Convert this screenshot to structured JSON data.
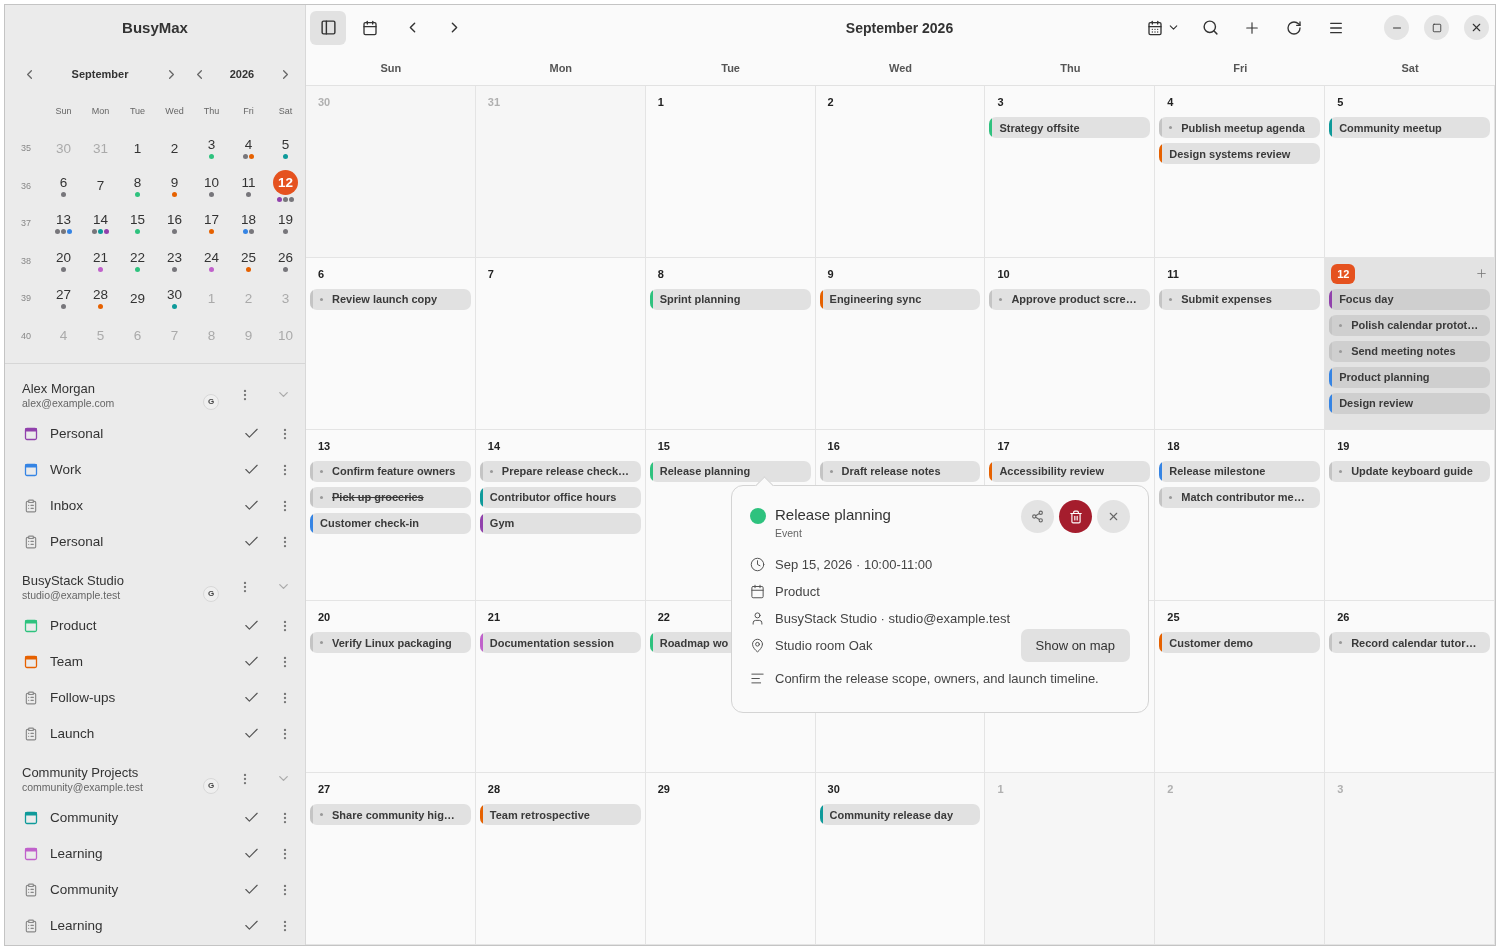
{
  "app_title": "BusyMax",
  "mini_calendar": {
    "month": "September",
    "year": "2026",
    "weekdays": [
      "Sun",
      "Mon",
      "Tue",
      "Wed",
      "Thu",
      "Fri",
      "Sat"
    ],
    "weeks": [
      {
        "week": "35",
        "days": [
          {
            "day": "30",
            "muted": true,
            "selected": false
          },
          {
            "day": "31",
            "muted": true,
            "selected": false
          },
          {
            "day": "1",
            "muted": false,
            "selected": false
          },
          {
            "day": "2",
            "muted": false,
            "selected": false
          },
          {
            "day": "3",
            "muted": false,
            "selected": false,
            "dots": [
              {
                "color": "#2ec27e"
              }
            ]
          },
          {
            "day": "4",
            "muted": false,
            "selected": false,
            "dots": [
              {
                "color": "#77767b"
              },
              {
                "color": "#e66100"
              }
            ]
          },
          {
            "day": "5",
            "muted": false,
            "selected": false,
            "dots": [
              {
                "color": "#0e9a9a"
              }
            ]
          }
        ]
      },
      {
        "week": "36",
        "days": [
          {
            "day": "6",
            "muted": false,
            "selected": false,
            "dots": [
              {
                "color": "#77767b"
              }
            ]
          },
          {
            "day": "7",
            "muted": false,
            "selected": false
          },
          {
            "day": "8",
            "muted": false,
            "selected": false,
            "dots": [
              {
                "color": "#2ec27e"
              }
            ]
          },
          {
            "day": "9",
            "muted": false,
            "selected": false,
            "dots": [
              {
                "color": "#e66100"
              }
            ]
          },
          {
            "day": "10",
            "muted": false,
            "selected": false,
            "dots": [
              {
                "color": "#77767b"
              }
            ]
          },
          {
            "day": "11",
            "muted": false,
            "selected": false,
            "dots": [
              {
                "color": "#77767b"
              }
            ]
          },
          {
            "day": "12",
            "muted": false,
            "selected": true,
            "dots": [
              {
                "color": "#9141ac"
              },
              {
                "color": "#77767b"
              },
              {
                "color": "#77767b"
              }
            ]
          }
        ]
      },
      {
        "week": "37",
        "days": [
          {
            "day": "13",
            "muted": false,
            "selected": false,
            "dots": [
              {
                "color": "#77767b"
              },
              {
                "color": "#77767b"
              },
              {
                "color": "#3584e4"
              }
            ]
          },
          {
            "day": "14",
            "muted": false,
            "selected": false,
            "dots": [
              {
                "color": "#77767b"
              },
              {
                "color": "#0e9a9a"
              },
              {
                "color": "#9141ac"
              }
            ]
          },
          {
            "day": "15",
            "muted": false,
            "selected": false,
            "dots": [
              {
                "color": "#2ec27e"
              }
            ]
          },
          {
            "day": "16",
            "muted": false,
            "selected": false,
            "dots": [
              {
                "color": "#77767b"
              }
            ]
          },
          {
            "day": "17",
            "muted": false,
            "selected": false,
            "dots": [
              {
                "color": "#e66100"
              }
            ]
          },
          {
            "day": "18",
            "muted": false,
            "selected": false,
            "dots": [
              {
                "color": "#3584e4"
              },
              {
                "color": "#77767b"
              }
            ]
          },
          {
            "day": "19",
            "muted": false,
            "selected": false,
            "dots": [
              {
                "color": "#77767b"
              }
            ]
          }
        ]
      },
      {
        "week": "38",
        "days": [
          {
            "day": "20",
            "muted": false,
            "selected": false,
            "dots": [
              {
                "color": "#77767b"
              }
            ]
          },
          {
            "day": "21",
            "muted": false,
            "selected": false,
            "dots": [
              {
                "color": "#c061cb"
              }
            ]
          },
          {
            "day": "22",
            "muted": false,
            "selected": false,
            "dots": [
              {
                "color": "#2ec27e"
              }
            ]
          },
          {
            "day": "23",
            "muted": false,
            "selected": false,
            "dots": [
              {
                "color": "#77767b"
              }
            ]
          },
          {
            "day": "24",
            "muted": false,
            "selected": false,
            "dots": [
              {
                "color": "#c061cb"
              }
            ]
          },
          {
            "day": "25",
            "muted": false,
            "selected": false,
            "dots": [
              {
                "color": "#e66100"
              }
            ]
          },
          {
            "day": "26",
            "muted": false,
            "selected": false,
            "dots": [
              {
                "color": "#77767b"
              }
            ]
          }
        ]
      },
      {
        "week": "39",
        "days": [
          {
            "day": "27",
            "muted": false,
            "selected": false,
            "dots": [
              {
                "color": "#77767b"
              }
            ]
          },
          {
            "day": "28",
            "muted": false,
            "selected": false,
            "dots": [
              {
                "color": "#e66100"
              }
            ]
          },
          {
            "day": "29",
            "muted": false,
            "selected": false
          },
          {
            "day": "30",
            "muted": false,
            "selected": false,
            "dots": [
              {
                "color": "#0e9a9a"
              }
            ]
          },
          {
            "day": "1",
            "muted": true,
            "selected": false
          },
          {
            "day": "2",
            "muted": true,
            "selected": false
          },
          {
            "day": "3",
            "muted": true,
            "selected": false
          }
        ]
      },
      {
        "week": "40",
        "days": [
          {
            "day": "4",
            "muted": true,
            "selected": false
          },
          {
            "day": "5",
            "muted": true,
            "selected": false
          },
          {
            "day": "6",
            "muted": true,
            "selected": false
          },
          {
            "day": "7",
            "muted": true,
            "selected": false
          },
          {
            "day": "8",
            "muted": true,
            "selected": false
          },
          {
            "day": "9",
            "muted": true,
            "selected": false
          },
          {
            "day": "10",
            "muted": true,
            "selected": false
          }
        ]
      }
    ]
  },
  "accounts": [
    {
      "name": "Alex Morgan",
      "email": "alex@example.com",
      "badge": "G",
      "expanded": true,
      "calendars": [
        {
          "name": "Personal",
          "kind": "calendar",
          "color": "#9141ac",
          "visible": true
        },
        {
          "name": "Work",
          "kind": "calendar",
          "color": "#3584e4",
          "visible": true
        },
        {
          "name": "Inbox",
          "kind": "tasks",
          "visible": true
        },
        {
          "name": "Personal",
          "kind": "tasks",
          "visible": true
        }
      ]
    },
    {
      "name": "BusyStack Studio",
      "email": "studio@example.test",
      "badge": "G",
      "expanded": true,
      "calendars": [
        {
          "name": "Product",
          "kind": "calendar",
          "color": "#2ec27e",
          "visible": true
        },
        {
          "name": "Team",
          "kind": "calendar",
          "color": "#e66100",
          "visible": true
        },
        {
          "name": "Follow-ups",
          "kind": "tasks",
          "visible": true
        },
        {
          "name": "Launch",
          "kind": "tasks",
          "visible": true
        }
      ]
    },
    {
      "name": "Community Projects",
      "email": "community@example.test",
      "badge": "G",
      "expanded": true,
      "calendars": [
        {
          "name": "Community",
          "kind": "calendar",
          "color": "#0e9a9a",
          "visible": true
        },
        {
          "name": "Learning",
          "kind": "calendar",
          "color": "#c061cb",
          "visible": true
        },
        {
          "name": "Community",
          "kind": "tasks",
          "visible": true
        },
        {
          "name": "Learning",
          "kind": "tasks",
          "visible": true
        }
      ]
    }
  ],
  "toolbar": {
    "title": "September 2026",
    "sidebar_open": true
  },
  "month_grid": {
    "weekdays": [
      "Sun",
      "Mon",
      "Tue",
      "Wed",
      "Thu",
      "Fri",
      "Sat"
    ],
    "cells": [
      {
        "day": "30",
        "muted": true,
        "today": false
      },
      {
        "day": "31",
        "muted": true,
        "today": false
      },
      {
        "day": "1",
        "muted": false,
        "today": false
      },
      {
        "day": "2",
        "muted": false,
        "today": false
      },
      {
        "day": "3",
        "muted": false,
        "today": false,
        "events": [
          {
            "title": "Strategy offsite",
            "kind": "event",
            "color": "#2ec27e",
            "done": false
          }
        ]
      },
      {
        "day": "4",
        "muted": false,
        "today": false,
        "events": [
          {
            "title": "Publish meetup agenda",
            "kind": "task",
            "done": false
          },
          {
            "title": "Design systems review",
            "kind": "event",
            "color": "#e66100",
            "done": false
          }
        ]
      },
      {
        "day": "5",
        "muted": false,
        "today": false,
        "events": [
          {
            "title": "Community meetup",
            "kind": "event",
            "color": "#0e9a9a",
            "done": false
          }
        ]
      },
      {
        "day": "6",
        "muted": false,
        "today": false,
        "events": [
          {
            "title": "Review launch copy",
            "kind": "task",
            "done": false
          }
        ]
      },
      {
        "day": "7",
        "muted": false,
        "today": false
      },
      {
        "day": "8",
        "muted": false,
        "today": false,
        "events": [
          {
            "title": "Sprint planning",
            "kind": "event",
            "color": "#2ec27e",
            "done": false
          }
        ]
      },
      {
        "day": "9",
        "muted": false,
        "today": false,
        "events": [
          {
            "title": "Engineering sync",
            "kind": "event",
            "color": "#e66100",
            "done": false
          }
        ]
      },
      {
        "day": "10",
        "muted": false,
        "today": false,
        "events": [
          {
            "title": "Approve product scre…",
            "kind": "task",
            "done": false
          }
        ]
      },
      {
        "day": "11",
        "muted": false,
        "today": false,
        "events": [
          {
            "title": "Submit expenses",
            "kind": "task",
            "done": false
          }
        ]
      },
      {
        "day": "12",
        "muted": false,
        "today": true,
        "events": [
          {
            "title": "Focus day",
            "kind": "event",
            "color": "#9141ac",
            "done": false
          },
          {
            "title": "Polish calendar protot…",
            "kind": "task",
            "done": false
          },
          {
            "title": "Send meeting notes",
            "kind": "task",
            "done": false
          },
          {
            "title": "Product planning",
            "kind": "event",
            "color": "#3584e4",
            "done": false
          },
          {
            "title": "Design review",
            "kind": "event",
            "color": "#3584e4",
            "done": false
          }
        ]
      },
      {
        "day": "13",
        "muted": false,
        "today": false,
        "events": [
          {
            "title": "Confirm feature owners",
            "kind": "task",
            "done": false
          },
          {
            "title": "Pick up groceries",
            "kind": "task",
            "done": true
          },
          {
            "title": "Customer check-in",
            "kind": "event",
            "color": "#3584e4",
            "done": false
          }
        ]
      },
      {
        "day": "14",
        "muted": false,
        "today": false,
        "events": [
          {
            "title": "Prepare release check…",
            "kind": "task",
            "done": false
          },
          {
            "title": "Contributor office hours",
            "kind": "event",
            "color": "#0e9a9a",
            "done": false
          },
          {
            "title": "Gym",
            "kind": "event",
            "color": "#9141ac",
            "done": false
          }
        ]
      },
      {
        "day": "15",
        "muted": false,
        "today": false,
        "events": [
          {
            "title": "Release planning",
            "kind": "event",
            "color": "#2ec27e",
            "done": false
          }
        ]
      },
      {
        "day": "16",
        "muted": false,
        "today": false,
        "events": [
          {
            "title": "Draft release notes",
            "kind": "task",
            "done": false
          }
        ]
      },
      {
        "day": "17",
        "muted": false,
        "today": false,
        "events": [
          {
            "title": "Accessibility review",
            "kind": "event",
            "color": "#e66100",
            "done": false
          }
        ]
      },
      {
        "day": "18",
        "muted": false,
        "today": false,
        "events": [
          {
            "title": "Release milestone",
            "kind": "event",
            "color": "#3584e4",
            "done": false
          },
          {
            "title": "Match contributor me…",
            "kind": "task",
            "done": false
          }
        ]
      },
      {
        "day": "19",
        "muted": false,
        "today": false,
        "events": [
          {
            "title": "Update keyboard guide",
            "kind": "task",
            "done": false
          }
        ]
      },
      {
        "day": "20",
        "muted": false,
        "today": false,
        "events": [
          {
            "title": "Verify Linux packaging",
            "kind": "task",
            "done": false
          }
        ]
      },
      {
        "day": "21",
        "muted": false,
        "today": false,
        "events": [
          {
            "title": "Documentation session",
            "kind": "event",
            "color": "#c061cb",
            "done": false
          }
        ]
      },
      {
        "day": "22",
        "muted": false,
        "today": false,
        "events": [
          {
            "title": "Roadmap wo",
            "kind": "event",
            "color": "#2ec27e",
            "done": false
          }
        ]
      },
      {
        "today": false
      },
      {
        "today": false
      },
      {
        "day": "25",
        "muted": false,
        "today": false,
        "events": [
          {
            "title": "Customer demo",
            "kind": "event",
            "color": "#e66100",
            "done": false
          }
        ]
      },
      {
        "day": "26",
        "muted": false,
        "today": false,
        "events": [
          {
            "title": "Record calendar tutor…",
            "kind": "task",
            "done": false
          }
        ]
      },
      {
        "day": "27",
        "muted": false,
        "today": false,
        "events": [
          {
            "title": "Share community hig…",
            "kind": "task",
            "done": false
          }
        ]
      },
      {
        "day": "28",
        "muted": false,
        "today": false,
        "events": [
          {
            "title": "Team retrospective",
            "kind": "event",
            "color": "#e66100",
            "done": false
          }
        ]
      },
      {
        "day": "29",
        "muted": false,
        "today": false
      },
      {
        "day": "30",
        "muted": false,
        "today": false,
        "events": [
          {
            "title": "Community release day",
            "kind": "event",
            "color": "#0e9a9a",
            "done": false
          }
        ]
      },
      {
        "day": "1",
        "muted": true,
        "today": false
      },
      {
        "day": "2",
        "muted": true,
        "today": false
      },
      {
        "day": "3",
        "muted": true,
        "today": false
      }
    ]
  },
  "popover": {
    "title": "Release planning",
    "color": "#2ec27e",
    "subtitle": "Event",
    "details": [
      {
        "kind": "time",
        "text": "Sep 15, 2026 · 10:00-11:00"
      },
      {
        "kind": "calendar",
        "text": "Product"
      },
      {
        "kind": "account",
        "text": "BusyStack Studio · studio@example.test"
      },
      {
        "kind": "location",
        "text": "Studio room Oak",
        "button": "Show on map"
      },
      {
        "kind": "description",
        "text": "Confirm the release scope, owners, and launch timeline."
      }
    ]
  }
}
